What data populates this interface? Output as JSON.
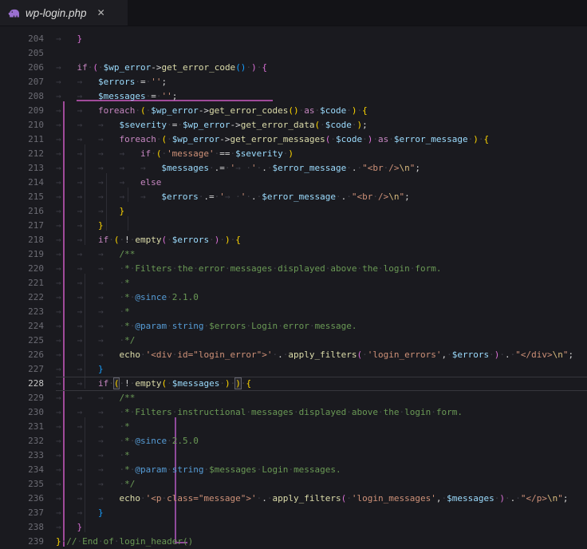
{
  "tab": {
    "title": "wp-login.php",
    "close_glyph": "✕",
    "icon": "php-elephant-icon"
  },
  "colors": {
    "editor_bg": "#1a1a1f",
    "tabbar_bg": "#131317",
    "active_tab_bg": "#1d1d22",
    "keyword": "#C586C0",
    "variable": "#9CDCFE",
    "function": "#DCDCAA",
    "string": "#CE9178",
    "escape": "#D7BA7D",
    "comment": "#6A9955",
    "doc_tag": "#569CD6",
    "bracket_gold": "#FFD700",
    "bracket_pink": "#DA70D6",
    "bracket_blue": "#179FFF",
    "active_guide": "#a04a9a",
    "line_number": "#6b6b73",
    "current_line_number": "#c6c6c6"
  },
  "editor": {
    "current_line": 228,
    "lines": [
      {
        "n": 204,
        "ind": 1,
        "tok": [
          [
            "b2",
            "}"
          ]
        ]
      },
      {
        "n": 205,
        "ind": 0,
        "tok": []
      },
      {
        "n": 206,
        "ind": 1,
        "tok": [
          [
            "k",
            "if"
          ],
          [
            "w",
            "·"
          ],
          [
            "b2",
            "("
          ],
          [
            "w",
            "·"
          ],
          [
            "v",
            "$wp_error"
          ],
          [
            "o",
            "->"
          ],
          [
            "f",
            "get_error_code"
          ],
          [
            "b3",
            "()"
          ],
          [
            "w",
            "·"
          ],
          [
            "b2",
            ")"
          ],
          [
            "w",
            "·"
          ],
          [
            "b2",
            "{"
          ]
        ]
      },
      {
        "n": 207,
        "ind": 2,
        "tok": [
          [
            "v",
            "$errors"
          ],
          [
            "w",
            "·"
          ],
          [
            "o",
            "="
          ],
          [
            "w",
            "·"
          ],
          [
            "s",
            "''"
          ],
          [
            "o",
            ";"
          ]
        ]
      },
      {
        "n": 208,
        "ind": 2,
        "tok": [
          [
            "v",
            "$messages"
          ],
          [
            "w",
            "·"
          ],
          [
            "o",
            "="
          ],
          [
            "w",
            "·"
          ],
          [
            "s",
            "''"
          ],
          [
            "o",
            ";"
          ]
        ]
      },
      {
        "n": 209,
        "ind": 2,
        "tok": [
          [
            "k",
            "foreach"
          ],
          [
            "w",
            "·"
          ],
          [
            "b1",
            "("
          ],
          [
            "w",
            "·"
          ],
          [
            "v",
            "$wp_error"
          ],
          [
            "o",
            "->"
          ],
          [
            "f",
            "get_error_codes"
          ],
          [
            "b1",
            "()"
          ],
          [
            "w",
            "·"
          ],
          [
            "k",
            "as"
          ],
          [
            "w",
            "·"
          ],
          [
            "v",
            "$code"
          ],
          [
            "w",
            "·"
          ],
          [
            "b1",
            ")"
          ],
          [
            "w",
            "·"
          ],
          [
            "b1",
            "{"
          ]
        ]
      },
      {
        "n": 210,
        "ind": 3,
        "tok": [
          [
            "v",
            "$severity"
          ],
          [
            "w",
            "·"
          ],
          [
            "o",
            "="
          ],
          [
            "w",
            "·"
          ],
          [
            "v",
            "$wp_error"
          ],
          [
            "o",
            "->"
          ],
          [
            "f",
            "get_error_data"
          ],
          [
            "b1",
            "("
          ],
          [
            "w",
            "·"
          ],
          [
            "v",
            "$code"
          ],
          [
            "w",
            "·"
          ],
          [
            "b1",
            ")"
          ],
          [
            "o",
            ";"
          ]
        ]
      },
      {
        "n": 211,
        "ind": 3,
        "tok": [
          [
            "k",
            "foreach"
          ],
          [
            "w",
            "·"
          ],
          [
            "b1",
            "("
          ],
          [
            "w",
            "·"
          ],
          [
            "v",
            "$wp_error"
          ],
          [
            "o",
            "->"
          ],
          [
            "f",
            "get_error_messages"
          ],
          [
            "b2",
            "("
          ],
          [
            "w",
            "·"
          ],
          [
            "v",
            "$code"
          ],
          [
            "w",
            "·"
          ],
          [
            "b2",
            ")"
          ],
          [
            "w",
            "·"
          ],
          [
            "k",
            "as"
          ],
          [
            "w",
            "·"
          ],
          [
            "v",
            "$error_message"
          ],
          [
            "w",
            "·"
          ],
          [
            "b1",
            ")"
          ],
          [
            "w",
            "·"
          ],
          [
            "b1",
            "{"
          ]
        ]
      },
      {
        "n": 212,
        "ind": 4,
        "tok": [
          [
            "k",
            "if"
          ],
          [
            "w",
            "·"
          ],
          [
            "b1",
            "("
          ],
          [
            "w",
            "·"
          ],
          [
            "s",
            "'message'"
          ],
          [
            "w",
            "·"
          ],
          [
            "o",
            "=="
          ],
          [
            "w",
            "·"
          ],
          [
            "v",
            "$severity"
          ],
          [
            "w",
            "·"
          ],
          [
            "b1",
            ")"
          ]
        ]
      },
      {
        "n": 213,
        "ind": 5,
        "tok": [
          [
            "v",
            "$messages"
          ],
          [
            "w",
            "·"
          ],
          [
            "o",
            ".="
          ],
          [
            "w",
            "·"
          ],
          [
            "s",
            "'"
          ],
          [
            "w",
            "→"
          ],
          [
            "w",
            "·"
          ],
          [
            "s",
            "'"
          ],
          [
            "w",
            "·"
          ],
          [
            "o",
            "."
          ],
          [
            "w",
            "·"
          ],
          [
            "v",
            "$error_message"
          ],
          [
            "w",
            "·"
          ],
          [
            "o",
            "."
          ],
          [
            "w",
            "·"
          ],
          [
            "s",
            "\"<br·/>"
          ],
          [
            "e",
            "\\n"
          ],
          [
            "s",
            "\""
          ],
          [
            "o",
            ";"
          ]
        ]
      },
      {
        "n": 214,
        "ind": 4,
        "tok": [
          [
            "k",
            "else"
          ]
        ]
      },
      {
        "n": 215,
        "ind": 5,
        "tok": [
          [
            "v",
            "$errors"
          ],
          [
            "w",
            "·"
          ],
          [
            "o",
            ".="
          ],
          [
            "w",
            "·"
          ],
          [
            "s",
            "'"
          ],
          [
            "w",
            "→"
          ],
          [
            "w",
            "·"
          ],
          [
            "s",
            "'"
          ],
          [
            "w",
            "·"
          ],
          [
            "o",
            "."
          ],
          [
            "w",
            "·"
          ],
          [
            "v",
            "$error_message"
          ],
          [
            "w",
            "·"
          ],
          [
            "o",
            "."
          ],
          [
            "w",
            "·"
          ],
          [
            "s",
            "\"<br·/>"
          ],
          [
            "e",
            "\\n"
          ],
          [
            "s",
            "\""
          ],
          [
            "o",
            ";"
          ]
        ]
      },
      {
        "n": 216,
        "ind": 3,
        "tok": [
          [
            "b1",
            "}"
          ]
        ]
      },
      {
        "n": 217,
        "ind": 2,
        "tok": [
          [
            "b1",
            "}"
          ]
        ]
      },
      {
        "n": 218,
        "ind": 2,
        "tok": [
          [
            "k",
            "if"
          ],
          [
            "w",
            "·"
          ],
          [
            "b1",
            "("
          ],
          [
            "w",
            "·"
          ],
          [
            "o",
            "!"
          ],
          [
            "w",
            "·"
          ],
          [
            "f",
            "empty"
          ],
          [
            "b2",
            "("
          ],
          [
            "w",
            "·"
          ],
          [
            "v",
            "$errors"
          ],
          [
            "w",
            "·"
          ],
          [
            "b2",
            ")"
          ],
          [
            "w",
            "·"
          ],
          [
            "b1",
            ")"
          ],
          [
            "w",
            "·"
          ],
          [
            "b1",
            "{"
          ]
        ]
      },
      {
        "n": 219,
        "ind": 3,
        "tok": [
          [
            "c",
            "/**"
          ]
        ]
      },
      {
        "n": 220,
        "ind": 3,
        "tok": [
          [
            "c",
            "·*·Filters·the·error·messages·displayed·above·the·login·form."
          ]
        ]
      },
      {
        "n": 221,
        "ind": 3,
        "tok": [
          [
            "c",
            "·*"
          ]
        ]
      },
      {
        "n": 222,
        "ind": 3,
        "tok": [
          [
            "c",
            "·*·"
          ],
          [
            "d",
            "@since"
          ],
          [
            "c",
            "·2.1.0"
          ]
        ]
      },
      {
        "n": 223,
        "ind": 3,
        "tok": [
          [
            "c",
            "·*"
          ]
        ]
      },
      {
        "n": 224,
        "ind": 3,
        "tok": [
          [
            "c",
            "·*·"
          ],
          [
            "d",
            "@param"
          ],
          [
            "c",
            "·"
          ],
          [
            "d",
            "string"
          ],
          [
            "c",
            "·$errors·Login·error·message."
          ]
        ]
      },
      {
        "n": 225,
        "ind": 3,
        "tok": [
          [
            "c",
            "·*/"
          ]
        ]
      },
      {
        "n": 226,
        "ind": 3,
        "tok": [
          [
            "f",
            "echo"
          ],
          [
            "w",
            "·"
          ],
          [
            "s",
            "'<div·id=\"login_error\">'"
          ],
          [
            "w",
            "·"
          ],
          [
            "o",
            "."
          ],
          [
            "w",
            "·"
          ],
          [
            "f",
            "apply_filters"
          ],
          [
            "b2",
            "("
          ],
          [
            "w",
            "·"
          ],
          [
            "s",
            "'login_errors'"
          ],
          [
            "o",
            ","
          ],
          [
            "w",
            "·"
          ],
          [
            "v",
            "$errors"
          ],
          [
            "w",
            "·"
          ],
          [
            "b2",
            ")"
          ],
          [
            "w",
            "·"
          ],
          [
            "o",
            "."
          ],
          [
            "w",
            "·"
          ],
          [
            "s",
            "\"</div>"
          ],
          [
            "e",
            "\\n"
          ],
          [
            "s",
            "\""
          ],
          [
            "o",
            ";"
          ]
        ]
      },
      {
        "n": 227,
        "ind": 2,
        "tok": [
          [
            "b3",
            "}"
          ]
        ]
      },
      {
        "n": 228,
        "ind": 2,
        "tok": [
          [
            "k",
            "if"
          ],
          [
            "w",
            "·"
          ],
          [
            "bm",
            "("
          ],
          [
            "w",
            "·"
          ],
          [
            "o",
            "!"
          ],
          [
            "w",
            "·"
          ],
          [
            "f",
            "empty"
          ],
          [
            "b1",
            "("
          ],
          [
            "w",
            "·"
          ],
          [
            "v",
            "$messages"
          ],
          [
            "w",
            "·"
          ],
          [
            "b1",
            ")"
          ],
          [
            "w",
            "·"
          ],
          [
            "bm",
            ")"
          ],
          [
            "w",
            "·"
          ],
          [
            "b1",
            "{"
          ]
        ]
      },
      {
        "n": 229,
        "ind": 3,
        "tok": [
          [
            "c",
            "/**"
          ]
        ]
      },
      {
        "n": 230,
        "ind": 3,
        "tok": [
          [
            "c",
            "·*·Filters·instructional·messages·displayed·above·the·login·form."
          ]
        ]
      },
      {
        "n": 231,
        "ind": 3,
        "tok": [
          [
            "c",
            "·*"
          ]
        ]
      },
      {
        "n": 232,
        "ind": 3,
        "tok": [
          [
            "c",
            "·*·"
          ],
          [
            "d",
            "@since"
          ],
          [
            "c",
            "·2.5.0"
          ]
        ]
      },
      {
        "n": 233,
        "ind": 3,
        "tok": [
          [
            "c",
            "·*"
          ]
        ]
      },
      {
        "n": 234,
        "ind": 3,
        "tok": [
          [
            "c",
            "·*·"
          ],
          [
            "d",
            "@param"
          ],
          [
            "c",
            "·"
          ],
          [
            "d",
            "string"
          ],
          [
            "c",
            "·$messages·Login·messages."
          ]
        ]
      },
      {
        "n": 235,
        "ind": 3,
        "tok": [
          [
            "c",
            "·*/"
          ]
        ]
      },
      {
        "n": 236,
        "ind": 3,
        "tok": [
          [
            "f",
            "echo"
          ],
          [
            "w",
            "·"
          ],
          [
            "s",
            "'<p·class=\"message\">'"
          ],
          [
            "w",
            "·"
          ],
          [
            "o",
            "."
          ],
          [
            "w",
            "·"
          ],
          [
            "f",
            "apply_filters"
          ],
          [
            "b2",
            "("
          ],
          [
            "w",
            "·"
          ],
          [
            "s",
            "'login_messages'"
          ],
          [
            "o",
            ","
          ],
          [
            "w",
            "·"
          ],
          [
            "v",
            "$messages"
          ],
          [
            "w",
            "·"
          ],
          [
            "b2",
            ")"
          ],
          [
            "w",
            "·"
          ],
          [
            "o",
            "."
          ],
          [
            "w",
            "·"
          ],
          [
            "s",
            "\"</p>"
          ],
          [
            "e",
            "\\n"
          ],
          [
            "s",
            "\""
          ],
          [
            "o",
            ";"
          ]
        ]
      },
      {
        "n": 237,
        "ind": 2,
        "tok": [
          [
            "b3",
            "}"
          ]
        ]
      },
      {
        "n": 238,
        "ind": 1,
        "tok": [
          [
            "b2",
            "}"
          ]
        ]
      },
      {
        "n": 239,
        "ind": 0,
        "tok": [
          [
            "b1",
            "}"
          ],
          [
            "w",
            "·"
          ],
          [
            "c",
            "//·End·of·login_header()"
          ]
        ]
      }
    ]
  }
}
